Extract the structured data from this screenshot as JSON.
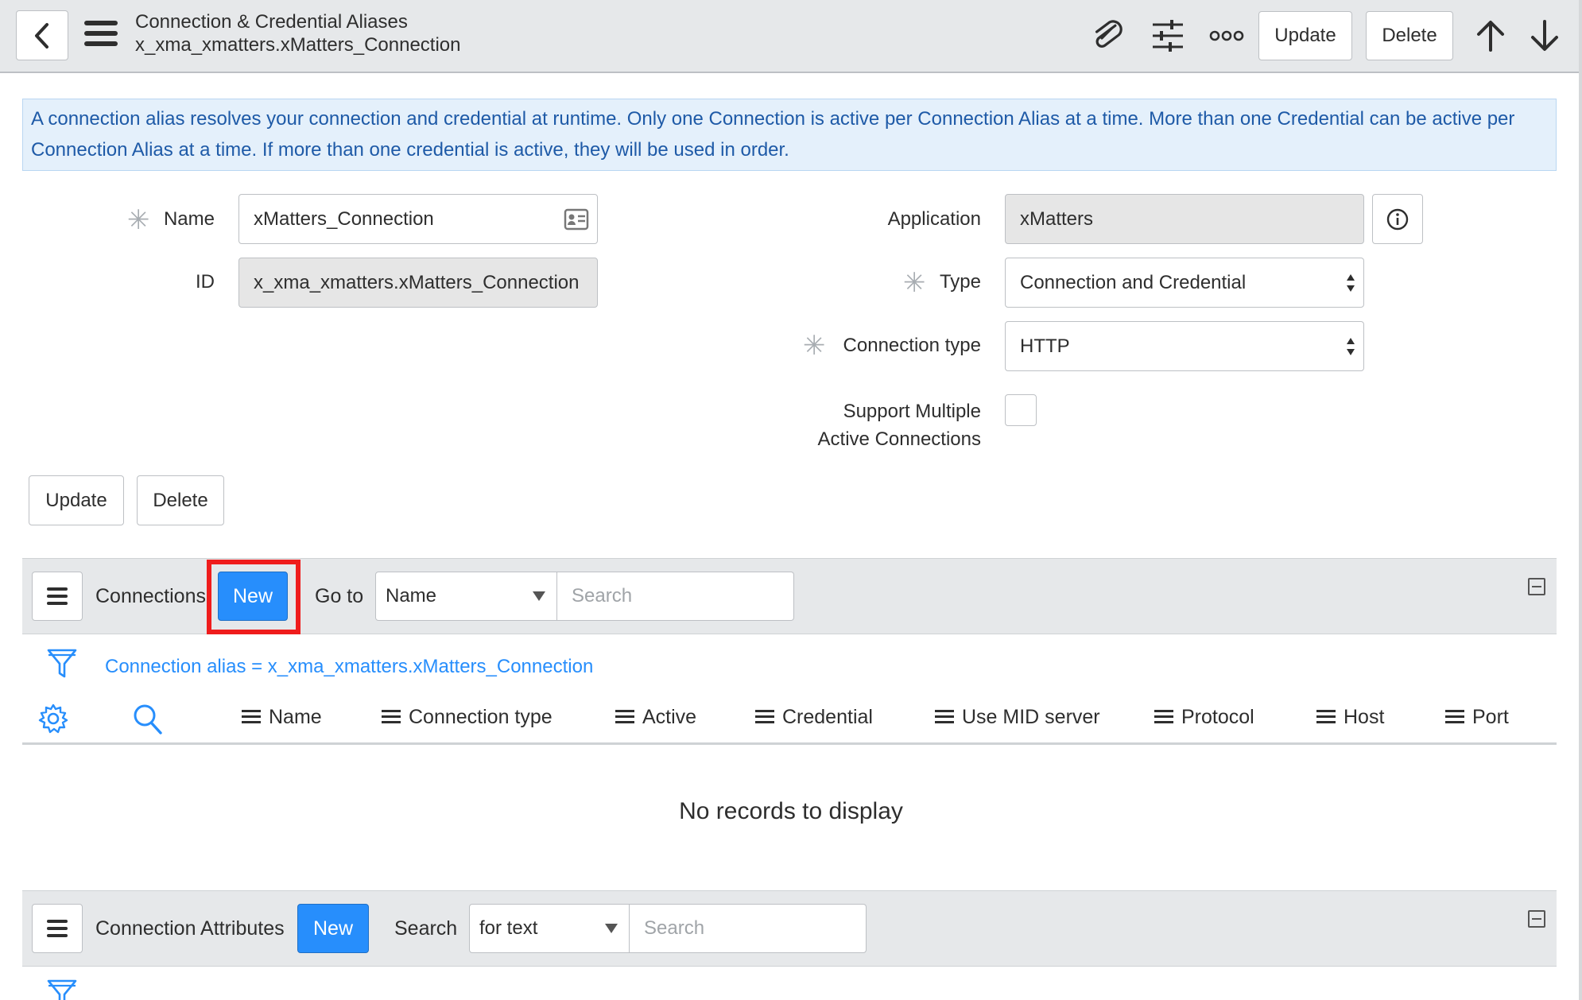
{
  "header": {
    "title": "Connection & Credential Aliases",
    "subtitle": "x_xma_xmatters.xMatters_Connection",
    "update_label": "Update",
    "delete_label": "Delete"
  },
  "info_message": "A connection alias resolves your connection and credential at runtime. Only one Connection is active per Connection Alias at a time. More than one Credential can be active per Connection Alias at a time. If more than one credential is active, they will be used in order.",
  "form": {
    "name_label": "Name",
    "name_value": "xMatters_Connection",
    "id_label": "ID",
    "id_value": "x_xma_xmatters.xMatters_Connection",
    "application_label": "Application",
    "application_value": "xMatters",
    "type_label": "Type",
    "type_value": "Connection and Credential",
    "connection_type_label": "Connection type",
    "connection_type_value": "HTTP",
    "support_multiple_label_line1": "Support Multiple",
    "support_multiple_label_line2": "Active Connections",
    "support_multiple_checked": false,
    "update_label": "Update",
    "delete_label": "Delete"
  },
  "connections_list": {
    "title": "Connections",
    "new_label": "New",
    "goto_label": "Go to",
    "goto_field": "Name",
    "search_placeholder": "Search",
    "filter_text": "Connection alias = x_xma_xmatters.xMatters_Connection",
    "columns": [
      "Name",
      "Connection type",
      "Active",
      "Credential",
      "Use MID server",
      "Protocol",
      "Host",
      "Port"
    ],
    "empty_message": "No records to display"
  },
  "attributes_list": {
    "title": "Connection Attributes",
    "new_label": "New",
    "search_label": "Search",
    "search_field": "for text",
    "search_placeholder": "Search"
  },
  "colors": {
    "accent": "#278efc",
    "highlight": "#ef1c1c",
    "info_bg": "#e4f0fb",
    "info_text": "#1e5aa7"
  }
}
